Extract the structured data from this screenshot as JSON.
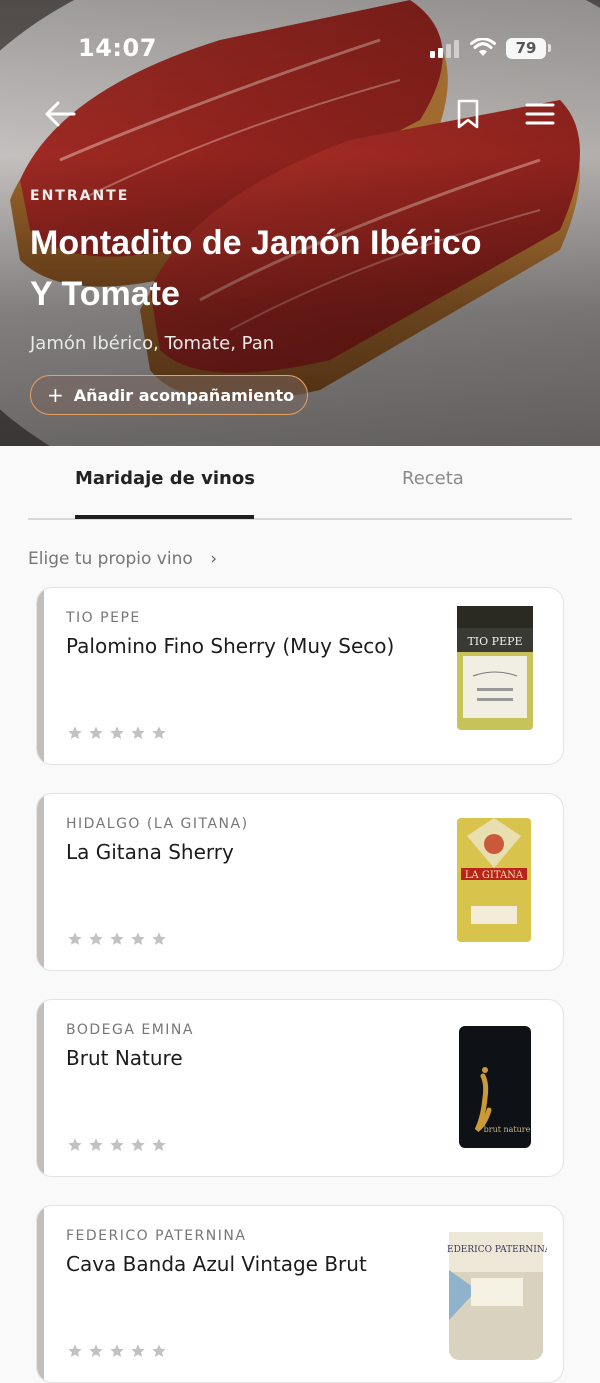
{
  "status_bar": {
    "time": "14:07",
    "battery": "79"
  },
  "hero": {
    "course": "ENTRANTE",
    "title_line1": "Montadito de Jamón Ibérico",
    "title_line2": "Y Tomate",
    "ingredients": "Jamón Ibérico, Tomate, Pan",
    "add_button": "Añadir acompañamiento",
    "add_icon": "plus-icon"
  },
  "tabs": [
    {
      "label": "Maridaje de vinos",
      "active": true
    },
    {
      "label": "Receta",
      "active": false
    }
  ],
  "choose_wine": {
    "label": "Elige tu propio vino",
    "icon": "chevron-right-icon"
  },
  "wines": [
    {
      "producer": "TIO PEPE",
      "name": "Palomino Fino Sherry (Muy Seco)",
      "rating": 0,
      "max_rating": 5,
      "label_text": "TIO PEPE"
    },
    {
      "producer": "HIDALGO (LA GITANA)",
      "name": "La Gitana Sherry",
      "rating": 0,
      "max_rating": 5,
      "label_text": "LA GITANA"
    },
    {
      "producer": "BODEGA EMINA",
      "name": "Brut Nature",
      "rating": 0,
      "max_rating": 5,
      "label_text": "brut nature"
    },
    {
      "producer": "FEDERICO PATERNINA",
      "name": "Cava Banda Azul Vintage Brut",
      "rating": 0,
      "max_rating": 5,
      "label_text": "FEDERICO PATERNINA"
    }
  ],
  "colors": {
    "accent_border": "#e6a060",
    "card_bar": "#c4bebb",
    "star": "#c2c2c2"
  }
}
